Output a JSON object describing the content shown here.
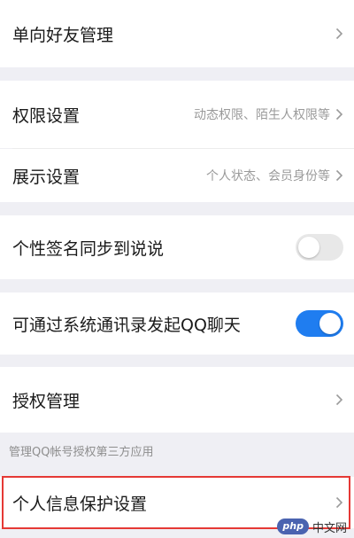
{
  "rows": {
    "one_way_friends": {
      "label": "单向好友管理"
    },
    "permissions": {
      "label": "权限设置",
      "value": "动态权限、陌生人权限等"
    },
    "display": {
      "label": "展示设置",
      "value": "个人状态、会员身份等"
    },
    "signature_sync": {
      "label": "个性签名同步到说说",
      "toggle": "off"
    },
    "contacts_chat": {
      "label": "可通过系统通讯录发起QQ聊天",
      "toggle": "on"
    },
    "authorization": {
      "label": "授权管理"
    },
    "personal_info": {
      "label": "个人信息保护设置"
    }
  },
  "hint": "管理QQ帐号授权第三方应用",
  "colors": {
    "toggle_on": "#1f7df0",
    "toggle_off": "#e8e8e8",
    "highlight": "#e53935",
    "background": "#efeff4"
  },
  "watermark": {
    "badge": "php",
    "text": "中文网"
  }
}
